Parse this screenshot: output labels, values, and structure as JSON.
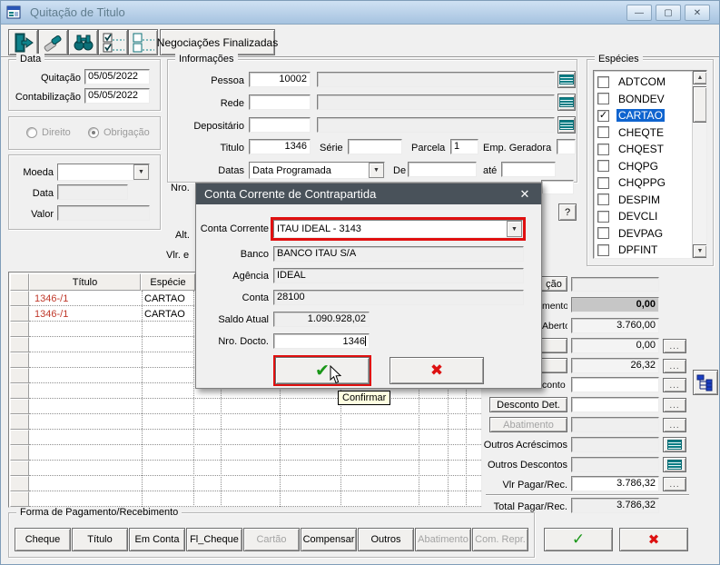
{
  "w": {
    "title": "Quitação de Titulo"
  },
  "toolbar": {
    "negociacoes": "Negociações Finalizadas"
  },
  "data_g": {
    "legend": "Data",
    "quitacao": "Quitação",
    "quitacao_v": "05/05/2022",
    "contab": "Contabilização",
    "contab_v": "05/05/2022"
  },
  "tipo": {
    "direito": "Direito",
    "obrigacao": "Obrigação",
    "selected": "Obrigação"
  },
  "moeda": {
    "moeda": "Moeda",
    "moeda_v": "",
    "data": "Data",
    "data_v": "",
    "valor": "Valor",
    "valor_v": ""
  },
  "info": {
    "legend": "Informações",
    "pessoa": "Pessoa",
    "pessoa_v": "10002",
    "rede": "Rede",
    "depositario": "Depositário",
    "titulo": "Titulo",
    "titulo_v": "1346",
    "serie": "Série",
    "serie_v": "",
    "parcela": "Parcela",
    "parcela_v": "1",
    "emp": "Emp. Geradora",
    "emp_v": "",
    "datas": "Datas",
    "datas_v": "Data Programada",
    "de": "De",
    "de_v": "",
    "ate": "até",
    "ate_v": ""
  },
  "frag": {
    "nro": "Nro.",
    "alt": "Alt.",
    "vlre": "Vlr. e",
    "q": "?",
    "cao": "ção",
    "mento": "mento",
    "aberto": "Aberto",
    "conto": "conto"
  },
  "especies": {
    "legend": "Espécies",
    "items": [
      {
        "label": "ADTCOM",
        "checked": false,
        "selected": false
      },
      {
        "label": "BONDEV",
        "checked": false,
        "selected": false
      },
      {
        "label": "CARTAO",
        "checked": true,
        "selected": true
      },
      {
        "label": "CHEQTE",
        "checked": false,
        "selected": false
      },
      {
        "label": "CHQEST",
        "checked": false,
        "selected": false
      },
      {
        "label": "CHQPG",
        "checked": false,
        "selected": false
      },
      {
        "label": "CHQPPG",
        "checked": false,
        "selected": false
      },
      {
        "label": "DESPIM",
        "checked": false,
        "selected": false
      },
      {
        "label": "DEVCLI",
        "checked": false,
        "selected": false
      },
      {
        "label": "DEVPAG",
        "checked": false,
        "selected": false
      },
      {
        "label": "DPFINT",
        "checked": false,
        "selected": false
      }
    ]
  },
  "grid": {
    "col_titulo": "Título",
    "col_especie": "Espécie",
    "rows": [
      {
        "titulo": "1346-/1",
        "especie": "CARTAO"
      },
      {
        "titulo": "1346-/1",
        "especie": "CARTAO"
      }
    ],
    "total_rows": 14
  },
  "panel": {
    "pagamento_v": "0,00",
    "aberto_v": "3.760,00",
    "juros_v": "0,00",
    "multa_v": "26,32",
    "desconto_det": "Desconto Det.",
    "abatimento": "Abatimento",
    "outros_acr": "Outros Acréscimos",
    "outros_desc": "Outros Descontos",
    "vlr_pagar": "Vlr Pagar/Rec.",
    "vlr_pagar_v": "3.786,32",
    "total": "Total Pagar/Rec.",
    "total_v": "3.786,32",
    "dots": "..."
  },
  "modal": {
    "title": "Conta Corrente de Contrapartida",
    "cc_label": "Conta Corrente",
    "cc_value": "ITAU IDEAL - 3143",
    "banco_l": "Banco",
    "banco_v": "BANCO ITAU S/A",
    "ag_l": "Agência",
    "ag_v": "IDEAL",
    "conta_l": "Conta",
    "conta_v": "28100",
    "saldo_l": "Saldo Atual",
    "saldo_v": "1.090.928,02",
    "nro_l": "Nro. Docto.",
    "nro_v": "1346"
  },
  "tooltip": {
    "text": "Confirmar"
  },
  "forma": {
    "legend": "Forma de Pagamento/Recebimento",
    "buttons": [
      {
        "label": "Cheque",
        "enabled": true
      },
      {
        "label": "Título",
        "enabled": true
      },
      {
        "label": "Em Conta",
        "enabled": true
      },
      {
        "label": "Fl_Cheque",
        "enabled": true
      },
      {
        "label": "Cartão",
        "enabled": false
      },
      {
        "label": "Compensar",
        "enabled": true
      },
      {
        "label": "Outros",
        "enabled": true
      },
      {
        "label": "Abatimento",
        "enabled": false
      },
      {
        "label": "Com. Repr.",
        "enabled": false
      }
    ]
  },
  "icons": {
    "close": "✕",
    "minimize": "—",
    "maximize": "▢",
    "dropdown": "▼",
    "check": "✔",
    "cross": "✖",
    "checkmark": "✓"
  },
  "colors": {
    "red_highlight": "#e01010",
    "green_check": "#1a9718",
    "red_cross": "#dd1111",
    "selection_blue": "#0f64cf",
    "grid_red_text": "#c0392b",
    "teal_icon": "#0b7d84",
    "modal_titlebar": "#49525a"
  }
}
